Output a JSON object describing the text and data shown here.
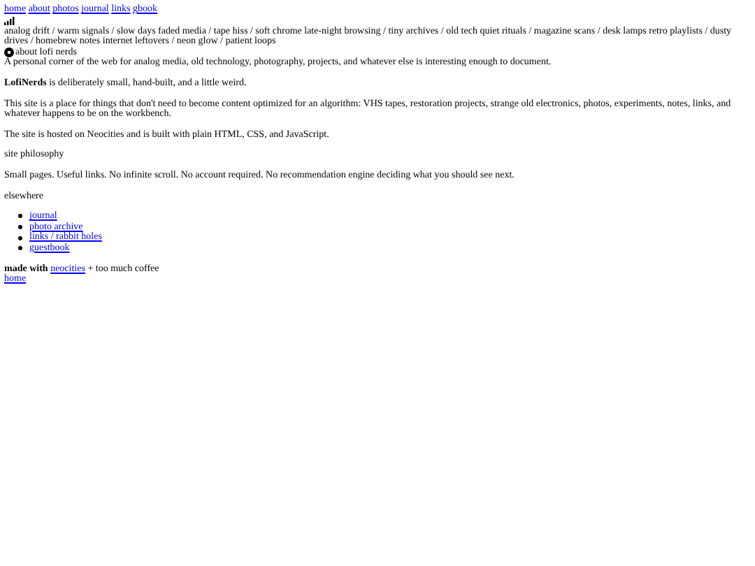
{
  "nav": [
    "home",
    "about",
    "photos",
    "journal",
    "links",
    "gbook"
  ],
  "tagline": "analog drift / warm signals / slow days faded media / tape hiss / soft chrome late-night browsing / tiny archives / old tech quiet rituals / magazine scans / desk lamps retro playlists / dusty drives / homebrew notes internet leftovers / neon glow / patient loops",
  "heading": "about lofi nerds",
  "intro": "A personal corner of the web for analog media, old technology, photography, projects, and whatever else is interesting enough to document.",
  "paragraphs": [
    "**LofiNerds** is deliberately small, hand-built, and a little weird.",
    "This site is a place for things that don't need to become content optimized for an algorithm: VHS tapes, restoration projects, strange old electronics, photos, experiments, notes, links, and whatever happens to be on the workbench.",
    "The site is hosted on Neocities and is built with plain HTML, CSS, and JavaScript."
  ],
  "philosophy": {
    "title": "site philosophy",
    "text": "Small pages. Useful links. No infinite scroll. No account required. No recommendation engine deciding what you should see next."
  },
  "elsewhere": {
    "title": "elsewhere",
    "links": [
      "journal",
      "photo archive",
      "links / rabbit holes",
      "guestbook"
    ]
  },
  "footer": {
    "bold": "made with",
    "link": "neocities",
    "text": "+ too much coffee",
    "home": "home"
  }
}
